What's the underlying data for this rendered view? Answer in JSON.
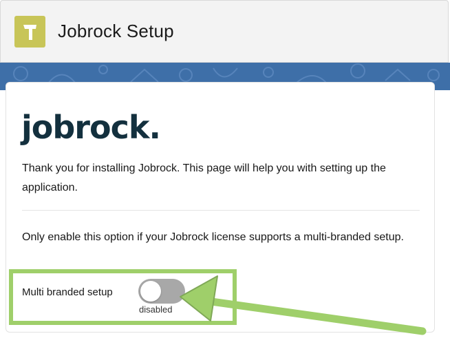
{
  "header": {
    "title": "Jobrock Setup",
    "icon": "hammer-icon",
    "icon_bg_color": "#c8c558"
  },
  "card": {
    "logo_text": "jobrock",
    "logo_dot": ".",
    "intro": "Thank you for installing Jobrock. This page will help you with setting up the application.",
    "note": "Only enable this option if your Jobrock license supports a multi-branded setup.",
    "toggle": {
      "label": "Multi branded setup",
      "status": "disabled",
      "enabled": false
    }
  },
  "annotation": {
    "color": "#9fcf6a"
  }
}
